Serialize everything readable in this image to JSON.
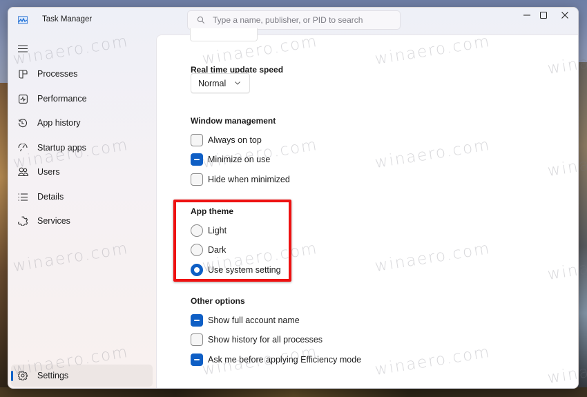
{
  "window": {
    "title": "Task Manager",
    "search_placeholder": "Type a name, publisher, or PID to search",
    "controls": {
      "minimize": "minimize-icon",
      "maximize": "maximize-icon",
      "close": "close-icon"
    }
  },
  "sidebar": {
    "menu_icon": "hamburger-icon",
    "items": [
      {
        "label": "Processes",
        "icon": "processes-icon"
      },
      {
        "label": "Performance",
        "icon": "performance-icon"
      },
      {
        "label": "App history",
        "icon": "app-history-icon"
      },
      {
        "label": "Startup apps",
        "icon": "startup-apps-icon"
      },
      {
        "label": "Users",
        "icon": "users-icon"
      },
      {
        "label": "Details",
        "icon": "details-icon"
      },
      {
        "label": "Services",
        "icon": "services-icon"
      }
    ],
    "settings": {
      "label": "Settings",
      "icon": "gear-icon",
      "active": true
    }
  },
  "settings": {
    "update_speed": {
      "title": "Real time update speed",
      "selected": "Normal"
    },
    "window_management": {
      "title": "Window management",
      "options": [
        {
          "label": "Always on top",
          "checked": false
        },
        {
          "label": "Minimize on use",
          "checked": true
        },
        {
          "label": "Hide when minimized",
          "checked": false
        }
      ]
    },
    "app_theme": {
      "title": "App theme",
      "options": [
        {
          "label": "Light",
          "selected": false
        },
        {
          "label": "Dark",
          "selected": false
        },
        {
          "label": "Use system setting",
          "selected": true
        }
      ]
    },
    "other_options": {
      "title": "Other options",
      "options": [
        {
          "label": "Show full account name",
          "checked": true
        },
        {
          "label": "Show history for all processes",
          "checked": false
        },
        {
          "label": "Ask me before applying Efficiency mode",
          "checked": true
        }
      ]
    }
  },
  "annotation": {
    "highlight_color": "#ee1111"
  },
  "colors": {
    "accent": "#0f5fc5"
  },
  "watermark": "winaero.com"
}
